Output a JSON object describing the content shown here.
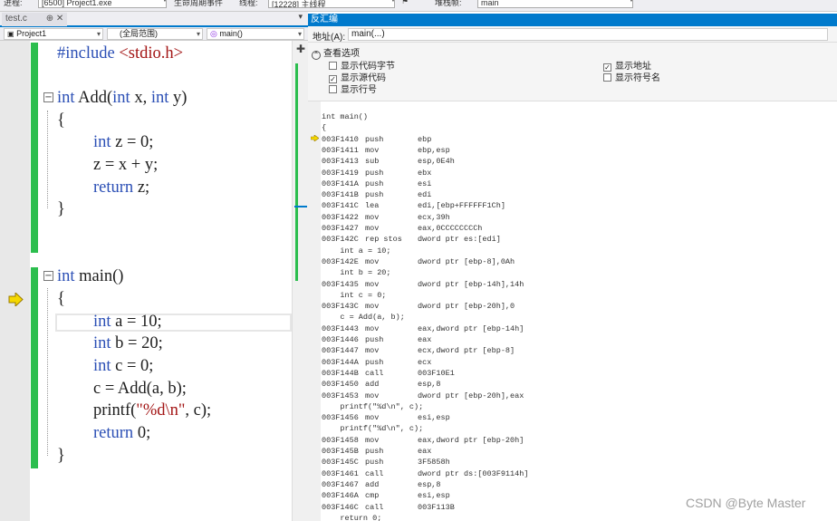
{
  "toolbar": {
    "process_label": "进程:",
    "process_value": "[6500] Project1.exe",
    "lifecycle_label": "生命周期事件",
    "thread_label": "线程:",
    "thread_value": "[12228] 主线程",
    "stack_label": "堆栈帧:",
    "stack_value": "main"
  },
  "editor_tab": {
    "label": "test.c",
    "pin": "⊕",
    "close": "✕"
  },
  "nav": {
    "project": "Project1",
    "scope": "(全局范围)",
    "function": "main()"
  },
  "code_lines": {
    "include_kw": "#include",
    "include_file": "<stdio.h>",
    "add_sig": "int Add(int x, int y)",
    "open1": "{",
    "decl_z": "int z = 0;",
    "assign_z": "z = x + y;",
    "ret_z": "return z;",
    "close1": "}",
    "main_sig": "int main()",
    "open2": "{",
    "decl_a": "int a = 10;",
    "decl_b": "int b = 20;",
    "decl_c": "int c = 0;",
    "call_add": "c = Add(a, b);",
    "printf_fn": "printf(",
    "printf_str": "\"%d\\n\"",
    "printf_rest": ", c);",
    "ret_0": "return 0;",
    "close2": "}"
  },
  "disasm": {
    "title": "反汇编",
    "address_label": "地址(A):",
    "address_value": "main(...)",
    "view_options_label": "查看选项",
    "options": [
      {
        "label": "显示代码字节",
        "checked": false
      },
      {
        "label": "显示源代码",
        "checked": true
      },
      {
        "label": "显示行号",
        "checked": false
      },
      {
        "label": "显示地址",
        "checked": true
      },
      {
        "label": "显示符号名",
        "checked": false
      }
    ],
    "lines": [
      {
        "src": "int main()"
      },
      {
        "src": "{"
      },
      {
        "addr": "003F1410",
        "mn": "push",
        "op": "ebp"
      },
      {
        "addr": "003F1411",
        "mn": "mov",
        "op": "ebp,esp"
      },
      {
        "addr": "003F1413",
        "mn": "sub",
        "op": "esp,0E4h"
      },
      {
        "addr": "003F1419",
        "mn": "push",
        "op": "ebx"
      },
      {
        "addr": "003F141A",
        "mn": "push",
        "op": "esi"
      },
      {
        "addr": "003F141B",
        "mn": "push",
        "op": "edi"
      },
      {
        "addr": "003F141C",
        "mn": "lea",
        "op": "edi,[ebp+FFFFFF1Ch]"
      },
      {
        "addr": "003F1422",
        "mn": "mov",
        "op": "ecx,39h"
      },
      {
        "addr": "003F1427",
        "mn": "mov",
        "op": "eax,0CCCCCCCCh"
      },
      {
        "addr": "003F142C",
        "mn": "rep stos",
        "op": "dword ptr es:[edi]"
      },
      {
        "src": "    int a = 10;"
      },
      {
        "addr": "003F142E",
        "mn": "mov",
        "op": "dword ptr [ebp-8],0Ah"
      },
      {
        "src": "    int b = 20;"
      },
      {
        "addr": "003F1435",
        "mn": "mov",
        "op": "dword ptr [ebp-14h],14h"
      },
      {
        "src": "    int c = 0;"
      },
      {
        "addr": "003F143C",
        "mn": "mov",
        "op": "dword ptr [ebp-20h],0"
      },
      {
        "src": "    c = Add(a, b);"
      },
      {
        "addr": "003F1443",
        "mn": "mov",
        "op": "eax,dword ptr [ebp-14h]"
      },
      {
        "addr": "003F1446",
        "mn": "push",
        "op": "eax"
      },
      {
        "addr": "003F1447",
        "mn": "mov",
        "op": "ecx,dword ptr [ebp-8]"
      },
      {
        "addr": "003F144A",
        "mn": "push",
        "op": "ecx"
      },
      {
        "addr": "003F144B",
        "mn": "call",
        "op": "003F10E1"
      },
      {
        "addr": "003F1450",
        "mn": "add",
        "op": "esp,8"
      },
      {
        "addr": "003F1453",
        "mn": "mov",
        "op": "dword ptr [ebp-20h],eax"
      },
      {
        "src": "    printf(\"%d\\n\", c);"
      },
      {
        "addr": "003F1456",
        "mn": "mov",
        "op": "esi,esp"
      },
      {
        "src": "    printf(\"%d\\n\", c);"
      },
      {
        "addr": "003F1458",
        "mn": "mov",
        "op": "eax,dword ptr [ebp-20h]"
      },
      {
        "addr": "003F145B",
        "mn": "push",
        "op": "eax"
      },
      {
        "addr": "003F145C",
        "mn": "push",
        "op": "3F5858h"
      },
      {
        "addr": "003F1461",
        "mn": "call",
        "op": "dword ptr ds:[003F9114h]"
      },
      {
        "addr": "003F1467",
        "mn": "add",
        "op": "esp,8"
      },
      {
        "addr": "003F146A",
        "mn": "cmp",
        "op": "esi,esp"
      },
      {
        "addr": "003F146C",
        "mn": "call",
        "op": "003F113B"
      },
      {
        "src": "    return 0;"
      }
    ]
  },
  "watermark": "CSDN @Byte Master",
  "colors": {
    "accent": "#007acc",
    "keyword": "#2b4fb5",
    "string": "#a31515",
    "change_bar": "#2cbe4e",
    "ip_arrow": "#f5d800"
  }
}
